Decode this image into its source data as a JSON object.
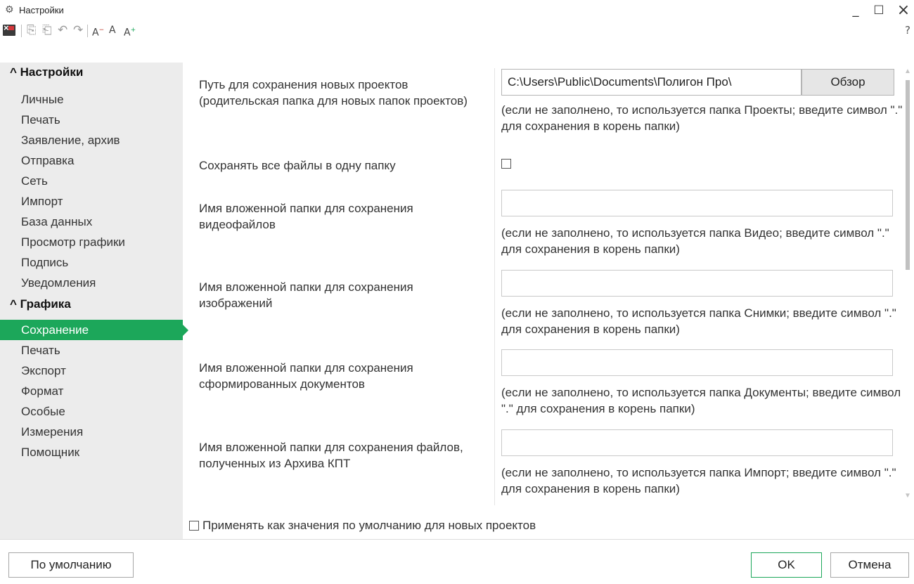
{
  "window": {
    "title": "Настройки",
    "icon": "gears-icon",
    "minimize": "_",
    "maximize": "☐",
    "close": "×",
    "help": "?"
  },
  "toolbar": {
    "items": [
      "close-project-icon",
      "copy-icon",
      "paste-icon",
      "undo-icon",
      "redo-icon",
      "font-decrease-icon",
      "font-normal-icon",
      "font-increase-icon"
    ]
  },
  "sidebar": {
    "groups": [
      {
        "header": "^ Настройки",
        "items": [
          "Личные",
          "Печать",
          "Заявление, архив",
          "Отправка",
          "Сеть",
          "Импорт",
          "База данных",
          "Просмотр графики",
          "Подпись",
          "Уведомления"
        ]
      },
      {
        "header": "^ Графика",
        "items": [
          "Сохранение",
          "Печать",
          "Экспорт",
          "Формат",
          "Особые",
          "Измерения",
          "Помощник"
        ]
      }
    ],
    "active_item": "Сохранение"
  },
  "settings": {
    "save_path": {
      "label": "Путь для сохранения новых проектов (родительская папка для новых папок проектов)",
      "value": "C:\\Users\\Public\\Documents\\Полигон Про\\",
      "browse": "Обзор",
      "hint": "(если не заполнено, то используется папка Проекты; введите символ \".\" для сохранения в корень папки)"
    },
    "single_folder": {
      "label": "Сохранять все файлы в одну папку",
      "checked": false
    },
    "video_folder": {
      "label": "Имя вложенной папки для сохранения видеофайлов",
      "value": "",
      "hint": "(если не заполнено, то используется папка Видео; введите символ \".\" для сохранения в корень папки)"
    },
    "images_folder": {
      "label": "Имя вложенной папки для сохранения изображений",
      "value": "",
      "hint": "(если не заполнено, то используется папка Снимки; введите символ \".\" для сохранения в корень папки)"
    },
    "docs_folder": {
      "label": "Имя вложенной папки для сохранения сформированных документов",
      "value": "",
      "hint": "(если не заполнено, то используется папка Документы; введите символ \".\" для сохранения в корень папки)"
    },
    "kpt_folder": {
      "label": "Имя вложенной папки для сохранения файлов, полученных из Архива КПТ",
      "value": "",
      "hint": "(если не заполнено, то используется папка Импорт; введите символ \".\" для сохранения в корень папки)"
    }
  },
  "apply_default": {
    "label": "Применять как значения по умолчанию для новых проектов",
    "checked": false
  },
  "buttons": {
    "defaults": "По умолчанию",
    "ok": "OK",
    "cancel": "Отмена"
  },
  "colors": {
    "accent": "#1ca75a",
    "sidebar_bg": "#ececec"
  }
}
